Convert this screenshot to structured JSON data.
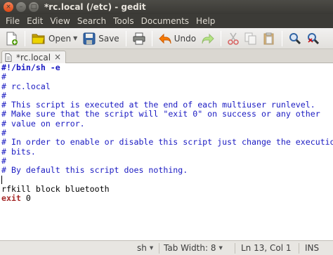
{
  "window": {
    "title": "*rc.local (/etc) - gedit",
    "buttons": {
      "close": "×",
      "minimize": "–",
      "maximize": "□"
    }
  },
  "menubar": {
    "items": [
      "File",
      "Edit",
      "View",
      "Search",
      "Tools",
      "Documents",
      "Help"
    ]
  },
  "toolbar": {
    "open_label": "Open",
    "save_label": "Save",
    "undo_label": "Undo",
    "icons": [
      "new-document-icon",
      "open-folder-icon",
      "save-icon",
      "print-icon",
      "undo-icon",
      "redo-icon",
      "cut-icon",
      "copy-icon",
      "paste-icon",
      "find-icon",
      "find-replace-icon"
    ]
  },
  "tabs": [
    {
      "label": "*rc.local",
      "close": "×"
    }
  ],
  "editor": {
    "lines": [
      "#!/bin/sh -e",
      "#",
      "# rc.local",
      "#",
      "# This script is executed at the end of each multiuser runlevel.",
      "# Make sure that the script will \"exit 0\" on success or any other",
      "# value on error.",
      "#",
      "# In order to enable or disable this script just change the execution",
      "# bits.",
      "#",
      "# By default this script does nothing.",
      "",
      "rfkill block bluetooth",
      "exit",
      "0"
    ]
  },
  "statusbar": {
    "language": "sh",
    "tab_width": "Tab Width: 8",
    "position": "Ln 13, Col 1",
    "mode": "INS"
  },
  "colors": {
    "comment": "#1a1ac2",
    "keyword": "#a52a2a",
    "titlebar_bg": "#3c3b37",
    "close_button": "#dd4814"
  }
}
